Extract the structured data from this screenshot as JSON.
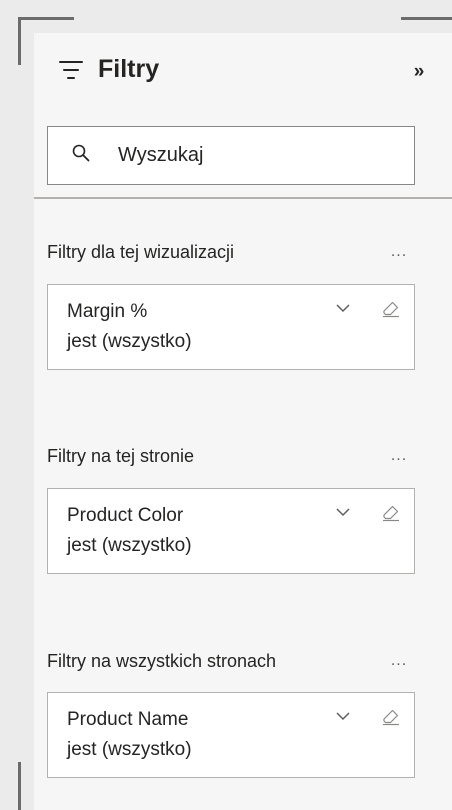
{
  "pane": {
    "title": "Filtry",
    "collapse_glyph": "»",
    "search": {
      "placeholder": "Wyszukaj",
      "value": ""
    }
  },
  "sections": [
    {
      "label": "Filtry dla tej wizualizacji",
      "more": "...",
      "card": {
        "name": "Margin %",
        "state": "jest (wszystko)"
      }
    },
    {
      "label": "Filtry na tej stronie",
      "more": "...",
      "card": {
        "name": "Product Color",
        "state": "jest (wszystko)"
      }
    },
    {
      "label": "Filtry na wszystkich stronach",
      "more": "...",
      "card": {
        "name": "Product Name",
        "state": "jest (wszystko)"
      }
    }
  ],
  "icons": {
    "header": "filter-icon",
    "search": "search-icon",
    "expand": "chevron-down-icon",
    "clear": "eraser-icon"
  },
  "colors": {
    "pane_background": "#f6f6f6",
    "outer_background": "#ebebeb",
    "text": "#252423",
    "border": "#b3b0ad"
  }
}
